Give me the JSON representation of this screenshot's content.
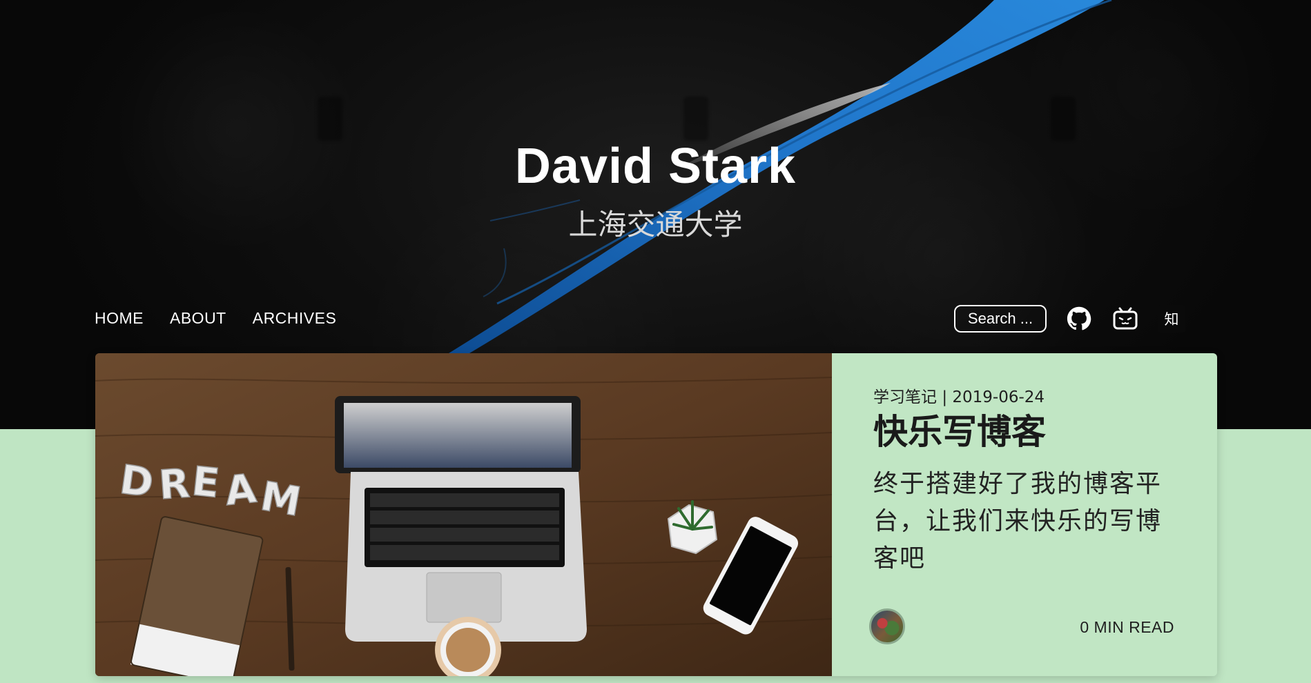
{
  "header": {
    "title": "David Stark",
    "subtitle": "上海交通大学"
  },
  "nav": {
    "links": [
      {
        "label": "HOME"
      },
      {
        "label": "ABOUT"
      },
      {
        "label": "ARCHIVES"
      }
    ],
    "search_label": "Search ...",
    "icons": [
      "github-icon",
      "bilibili-icon",
      "zhihu-icon"
    ],
    "zhihu_label": "知"
  },
  "post": {
    "category": "学习笔记",
    "separator": "|",
    "date": "2019-06-24",
    "title": "快乐写博客",
    "excerpt": "终于搭建好了我的博客平台，让我们来快乐的写博客吧",
    "read_time": "0 MIN READ",
    "image_letters": "DREAM"
  },
  "colors": {
    "page_background": "#bfe5c3",
    "hero_background": "#0f0f0f",
    "ribbon_blue": "#1f73c8",
    "card_body": "#c1e6c4"
  }
}
